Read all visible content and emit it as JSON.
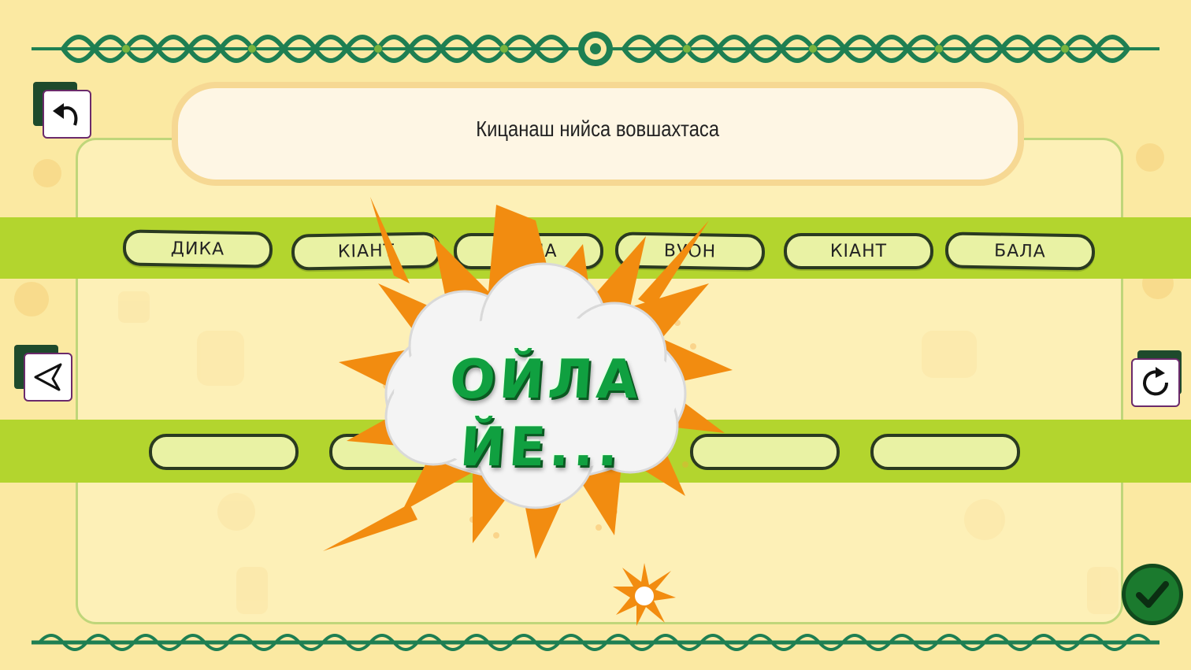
{
  "question": {
    "text": "Кицанаш нийса вовшахтаса"
  },
  "word_tiles": [
    "ДИКА",
    "КIАНТ",
    "ЧIАЛА",
    "ВУОН",
    "КIАНТ",
    "БАЛА"
  ],
  "answer_slots": 5,
  "feedback": {
    "line1": "ОЙЛА",
    "line2": "ЙЕ..."
  },
  "icons": {
    "back": "undo-arrow-icon",
    "previous": "triangle-left-icon",
    "restart": "refresh-icon",
    "confirm": "checkmark-icon"
  },
  "colors": {
    "background": "#fbe9a2",
    "band": "#b3d52e",
    "tile": "#e9f2a4",
    "ornament": "#1e7f52",
    "burst": "#f28c10",
    "feedback_text": "#10a040",
    "confirm": "#1b7a2e"
  }
}
